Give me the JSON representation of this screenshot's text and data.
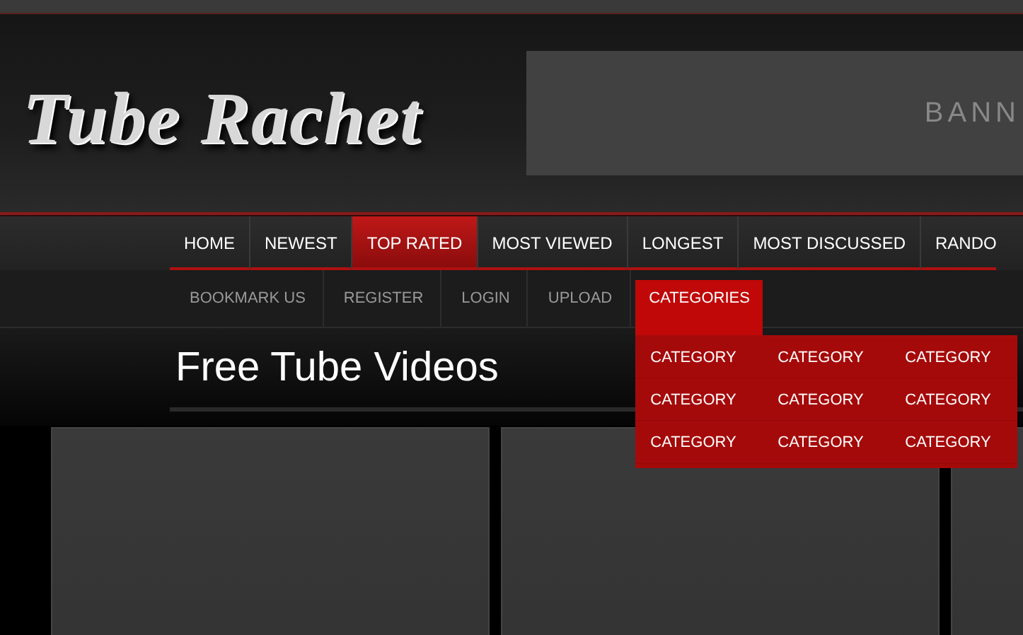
{
  "logo": {
    "text": "Tube Rachet"
  },
  "banner": {
    "text": "BANN"
  },
  "main_nav": [
    {
      "label": "HOME",
      "selected": false
    },
    {
      "label": "NEWEST",
      "selected": false
    },
    {
      "label": "TOP RATED",
      "selected": true
    },
    {
      "label": "MOST VIEWED",
      "selected": false
    },
    {
      "label": "LONGEST",
      "selected": false
    },
    {
      "label": "MOST DISCUSSED",
      "selected": false
    },
    {
      "label": "RANDO",
      "selected": false
    }
  ],
  "sub_nav": [
    {
      "label": "BOOKMARK US",
      "expanded": false
    },
    {
      "label": "REGISTER",
      "expanded": false
    },
    {
      "label": "LOGIN",
      "expanded": false
    },
    {
      "label": "UPLOAD",
      "expanded": false
    },
    {
      "label": "CATEGORIES",
      "expanded": true,
      "menu": [
        "CATEGORY",
        "CATEGORY",
        "CATEGORY",
        "CATEGORY",
        "CATEGORY",
        "CATEGORY",
        "CATEGORY",
        "CATEGORY",
        "CATEGORY"
      ]
    }
  ],
  "page_title": "Free Tube Videos"
}
